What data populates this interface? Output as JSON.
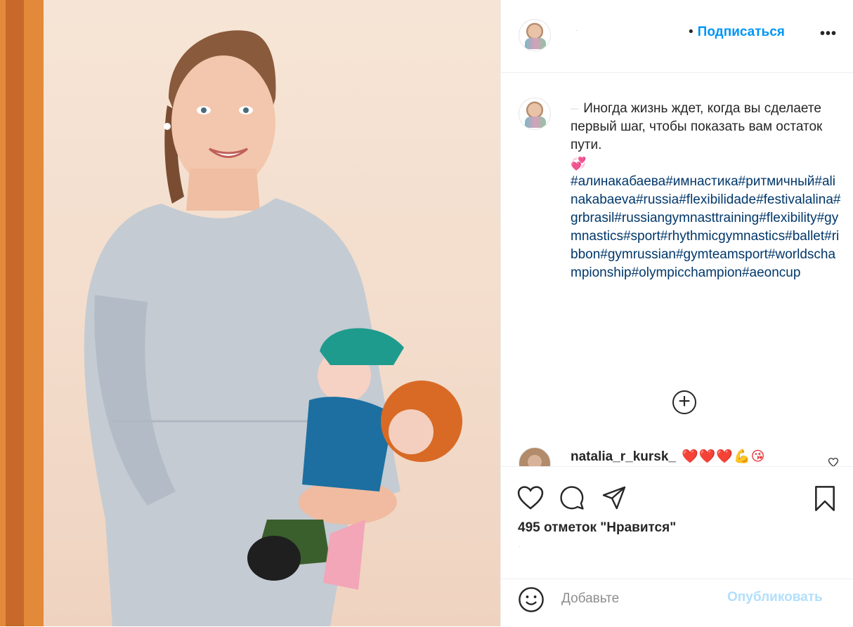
{
  "post": {
    "author_name_blurred": "·",
    "follow_label": "Подписаться",
    "follow_separator": "•",
    "more_label": "•••",
    "caption": {
      "author_blurred": "—",
      "text": "Иногда жизнь ждет, когда вы сделаете первый шаг, чтобы показать вам остаток пути.",
      "emoji": "💞",
      "hashtags": "#алинакабаева#имнастика#ритмичный#alinakabaeva#russia#flexibilidade#festivalalina#grbrasil#russiangymnasttraining#flexibility#gymnastics#sport#rhythmicgymnastics#ballet#ribbon#gymrussian#gymteamsport#worldschampionship#olympicchampion#aeoncup"
    },
    "load_more_label": "+",
    "comment": {
      "username": "natalia_r_kursk_",
      "emoji": "❤️❤️❤️💪😘",
      "like_icon": "heart-outline-icon"
    },
    "likes_text": "495 отметок \"Нравится\"",
    "timestamp_blurred": "·",
    "add_comment": {
      "placeholder": "Добавьте",
      "publish_label": "Опубликовать"
    },
    "icons": [
      "heart-outline-icon",
      "comment-icon",
      "share-icon",
      "bookmark-icon",
      "emoji-icon",
      "ellipsis-icon"
    ],
    "colors": {
      "link": "#0095f6",
      "hashtag": "#00376b",
      "publish_disabled": "#b2dffc",
      "text": "#262626",
      "placeholder": "#8e8e8e"
    }
  }
}
